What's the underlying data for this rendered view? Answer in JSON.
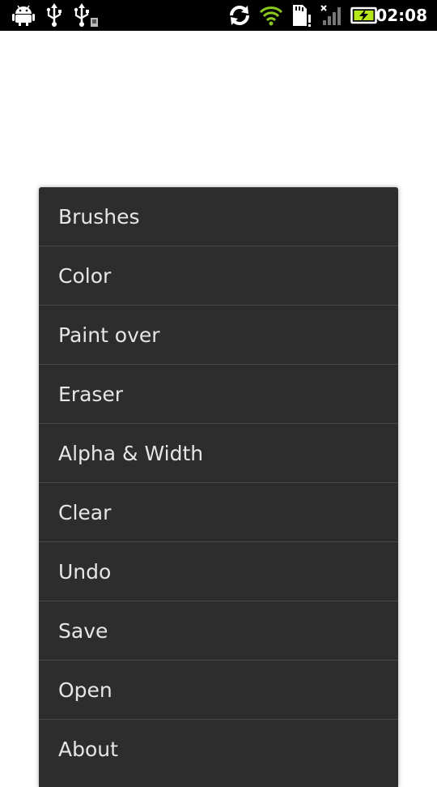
{
  "status_bar": {
    "time": "02:08",
    "icons": [
      "android-debug-icon",
      "usb-icon",
      "usb-storage-icon",
      "sync-icon",
      "wifi-icon",
      "sd-card-icon",
      "no-signal-icon",
      "battery-charging-icon"
    ],
    "wifi_color": "#8ac820",
    "battery_color": "#b6e71b"
  },
  "menu": {
    "items": [
      {
        "label": "Brushes"
      },
      {
        "label": "Color"
      },
      {
        "label": "Paint over"
      },
      {
        "label": "Eraser"
      },
      {
        "label": "Alpha & Width"
      },
      {
        "label": "Clear"
      },
      {
        "label": "Undo"
      },
      {
        "label": "Save"
      },
      {
        "label": "Open"
      },
      {
        "label": "About"
      }
    ]
  }
}
